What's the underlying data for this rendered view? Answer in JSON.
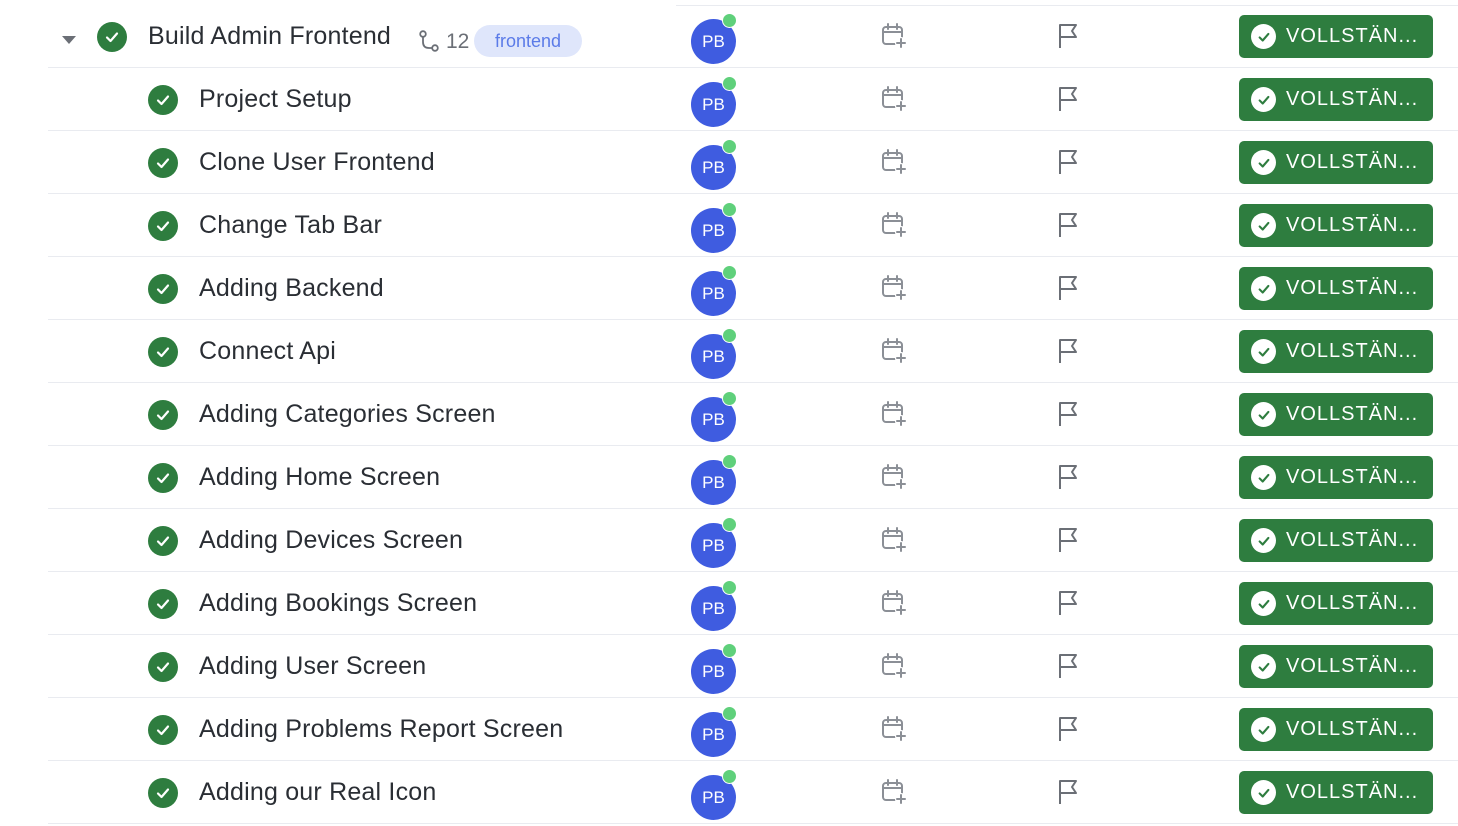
{
  "parent_task": {
    "name": "Build Admin Frontend",
    "subtask_count": "12",
    "tag": "frontend",
    "assignee_initials": "PB",
    "status": "VOLLSTÄN..."
  },
  "subtasks": [
    {
      "name": "Project Setup",
      "assignee_initials": "PB",
      "status": "VOLLSTÄN..."
    },
    {
      "name": "Clone User Frontend",
      "assignee_initials": "PB",
      "status": "VOLLSTÄN..."
    },
    {
      "name": "Change Tab Bar",
      "assignee_initials": "PB",
      "status": "VOLLSTÄN..."
    },
    {
      "name": "Adding Backend",
      "assignee_initials": "PB",
      "status": "VOLLSTÄN..."
    },
    {
      "name": "Connect Api",
      "assignee_initials": "PB",
      "status": "VOLLSTÄN..."
    },
    {
      "name": "Adding Categories Screen",
      "assignee_initials": "PB",
      "status": "VOLLSTÄN..."
    },
    {
      "name": "Adding Home Screen",
      "assignee_initials": "PB",
      "status": "VOLLSTÄN..."
    },
    {
      "name": "Adding Devices Screen",
      "assignee_initials": "PB",
      "status": "VOLLSTÄN..."
    },
    {
      "name": "Adding Bookings Screen",
      "assignee_initials": "PB",
      "status": "VOLLSTÄN..."
    },
    {
      "name": "Adding User Screen",
      "assignee_initials": "PB",
      "status": "VOLLSTÄN..."
    },
    {
      "name": "Adding Problems Report Screen",
      "assignee_initials": "PB",
      "status": "VOLLSTÄN..."
    },
    {
      "name": "Adding our Real Icon",
      "assignee_initials": "PB",
      "status": "VOLLSTÄN..."
    }
  ],
  "colors": {
    "complete_green": "#2e7d3f",
    "avatar_blue": "#3f5ce0",
    "online_green": "#5fd07b",
    "tag_background": "#dfe6fb",
    "tag_text": "#5b7be8"
  },
  "icons": {
    "expand": "caret-down-icon",
    "complete": "check-circle-icon",
    "subtasks": "subtask-icon",
    "due_date": "calendar-plus-icon",
    "priority": "flag-icon"
  }
}
